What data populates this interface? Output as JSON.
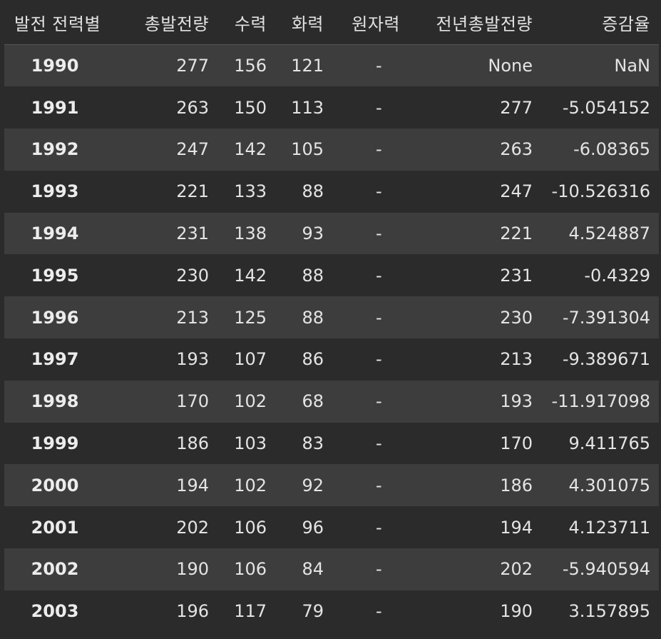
{
  "columns": {
    "index": "발전 전력별",
    "total": "총발전량",
    "hydro": "수력",
    "thermal": "화력",
    "nuclear": "원자력",
    "prev_total": "전년총발전량",
    "rate": "증감율"
  },
  "rows": [
    {
      "year": "1990",
      "total": "277",
      "hydro": "156",
      "thermal": "121",
      "nuclear": "-",
      "prev_total": "None",
      "rate": "NaN"
    },
    {
      "year": "1991",
      "total": "263",
      "hydro": "150",
      "thermal": "113",
      "nuclear": "-",
      "prev_total": "277",
      "rate": "-5.054152"
    },
    {
      "year": "1992",
      "total": "247",
      "hydro": "142",
      "thermal": "105",
      "nuclear": "-",
      "prev_total": "263",
      "rate": "-6.08365"
    },
    {
      "year": "1993",
      "total": "221",
      "hydro": "133",
      "thermal": "88",
      "nuclear": "-",
      "prev_total": "247",
      "rate": "-10.526316"
    },
    {
      "year": "1994",
      "total": "231",
      "hydro": "138",
      "thermal": "93",
      "nuclear": "-",
      "prev_total": "221",
      "rate": "4.524887"
    },
    {
      "year": "1995",
      "total": "230",
      "hydro": "142",
      "thermal": "88",
      "nuclear": "-",
      "prev_total": "231",
      "rate": "-0.4329"
    },
    {
      "year": "1996",
      "total": "213",
      "hydro": "125",
      "thermal": "88",
      "nuclear": "-",
      "prev_total": "230",
      "rate": "-7.391304"
    },
    {
      "year": "1997",
      "total": "193",
      "hydro": "107",
      "thermal": "86",
      "nuclear": "-",
      "prev_total": "213",
      "rate": "-9.389671"
    },
    {
      "year": "1998",
      "total": "170",
      "hydro": "102",
      "thermal": "68",
      "nuclear": "-",
      "prev_total": "193",
      "rate": "-11.917098"
    },
    {
      "year": "1999",
      "total": "186",
      "hydro": "103",
      "thermal": "83",
      "nuclear": "-",
      "prev_total": "170",
      "rate": "9.411765"
    },
    {
      "year": "2000",
      "total": "194",
      "hydro": "102",
      "thermal": "92",
      "nuclear": "-",
      "prev_total": "186",
      "rate": "4.301075"
    },
    {
      "year": "2001",
      "total": "202",
      "hydro": "106",
      "thermal": "96",
      "nuclear": "-",
      "prev_total": "194",
      "rate": "4.123711"
    },
    {
      "year": "2002",
      "total": "190",
      "hydro": "106",
      "thermal": "84",
      "nuclear": "-",
      "prev_total": "202",
      "rate": "-5.940594"
    },
    {
      "year": "2003",
      "total": "196",
      "hydro": "117",
      "thermal": "79",
      "nuclear": "-",
      "prev_total": "190",
      "rate": "3.157895"
    }
  ],
  "colors": {
    "background": "#2b2b2b",
    "row_stripe": "#3d3d3d",
    "text": "#e4e4e4",
    "header_border": "#555555"
  }
}
